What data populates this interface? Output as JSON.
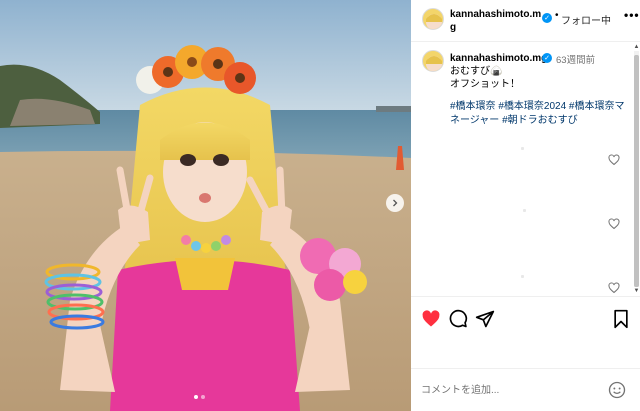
{
  "post": {
    "username": "kannahashimoto.mg",
    "follow_label": "フォロー中",
    "more_label": "•••",
    "separator": "•",
    "photo": {
      "slide_count": 2,
      "current_slide": 1
    }
  },
  "caption": {
    "username": "kannahashimoto.mg",
    "time": "63週間前",
    "line1": "おむすび🍙",
    "line2": "オフショット！",
    "hashtags": "#橋本環奈 #橋本環奈2024 #橋本環奈マネージャー #朝ドラおむすび"
  },
  "comment_box": {
    "placeholder": "コメントを追加..."
  },
  "icons": {
    "like": "heart-filled-icon",
    "comment": "comment-bubble-icon",
    "share": "paper-plane-icon",
    "save": "bookmark-icon",
    "emoji": "smiley-icon",
    "next": "chevron-right-icon",
    "verified": "verified-badge-icon",
    "comment_like": "heart-outline-icon"
  },
  "colors": {
    "like_red": "#ff3040",
    "verified_blue": "#0095f6",
    "hashtag_blue": "#00376b",
    "muted_text": "#737373"
  }
}
